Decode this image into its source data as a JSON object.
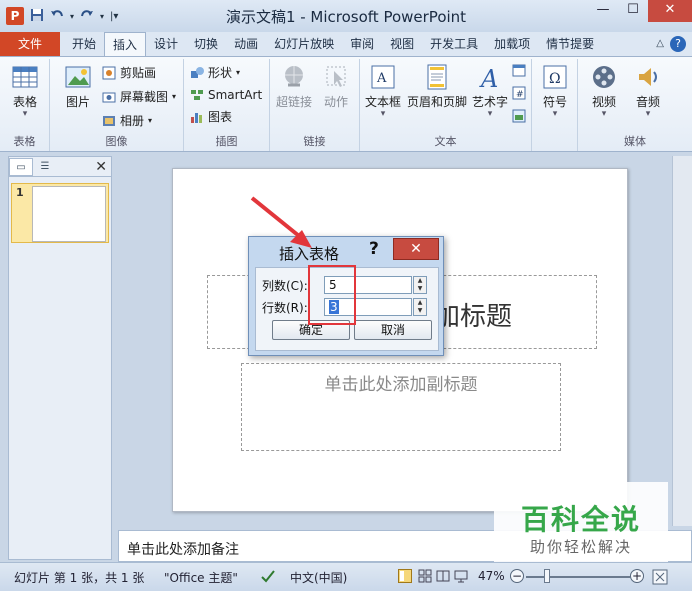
{
  "window": {
    "title": "演示文稿1 - Microsoft PowerPoint",
    "app_icon": "P",
    "minimize": "—",
    "maximize": "☐",
    "close": "✕"
  },
  "tabs": [
    {
      "label": "文件"
    },
    {
      "label": "开始"
    },
    {
      "label": "插入"
    },
    {
      "label": "设计"
    },
    {
      "label": "切换"
    },
    {
      "label": "动画"
    },
    {
      "label": "幻灯片放映"
    },
    {
      "label": "审阅"
    },
    {
      "label": "视图"
    },
    {
      "label": "开发工具"
    },
    {
      "label": "加载项"
    },
    {
      "label": "情节提要"
    }
  ],
  "ribbon": {
    "groups": {
      "tables": {
        "label": "表格",
        "table": "表格"
      },
      "images": {
        "label": "图像",
        "picture": "图片",
        "clipart": "剪贴画",
        "screenshot": "屏幕截图",
        "album": "相册"
      },
      "illustrations": {
        "label": "插图",
        "shapes": "形状",
        "smartart": "SmartArt",
        "chart": "图表"
      },
      "links": {
        "label": "链接",
        "hyperlink": "超链接",
        "action": "动作"
      },
      "text": {
        "label": "文本",
        "textbox": "文本框",
        "header_footer": "页眉和页脚",
        "wordart": "艺术字"
      },
      "symbols": {
        "symbol": "符号"
      },
      "media": {
        "label": "媒体",
        "video": "视频",
        "audio": "音频"
      }
    }
  },
  "slides_pane": {
    "slide_number": "1"
  },
  "slide": {
    "title_placeholder_visible": "加标题",
    "subtitle_placeholder": "单击此处添加副标题"
  },
  "notes": {
    "placeholder": "单击此处添加备注"
  },
  "dialog": {
    "title": "插入表格",
    "help": "?",
    "close": "✕",
    "columns_label": "列数(C):",
    "columns_value": "5",
    "rows_label": "行数(R):",
    "rows_value": "3",
    "ok": "确定",
    "cancel": "取消"
  },
  "status_bar": {
    "slide_info": "幻灯片 第 1 张，共 1 张",
    "theme": "\"Office 主题\"",
    "language": "中文(中国)",
    "zoom": "47%"
  },
  "watermark": {
    "main": "百科全说",
    "sub": "助你轻松解决"
  },
  "colors": {
    "file_tab": "#d24726",
    "close_button": "#c74b40",
    "annotation": "#e2363b",
    "watermark_green": "#36a74a"
  }
}
